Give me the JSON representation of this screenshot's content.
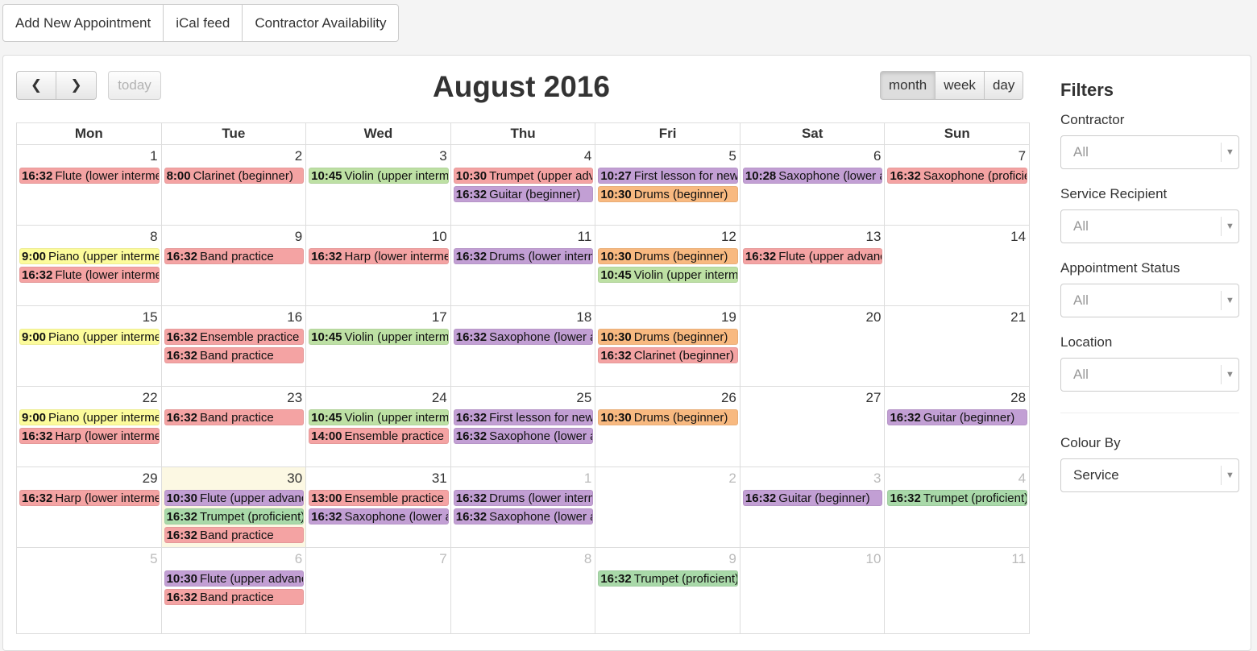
{
  "toolbar": {
    "add_appointment": "Add New Appointment",
    "ical_feed": "iCal feed",
    "contractor_availability": "Contractor Availability"
  },
  "calendar": {
    "title": "August 2016",
    "prev_icon": "❮",
    "next_icon": "❯",
    "today_label": "today",
    "views": {
      "month": "month",
      "week": "week",
      "day": "day"
    },
    "days_of_week": [
      "Mon",
      "Tue",
      "Wed",
      "Thu",
      "Fri",
      "Sat",
      "Sun"
    ],
    "colors": {
      "red": "#f4a3a3",
      "purple": "#c29fd4",
      "green": "#bde0a4",
      "orange": "#f8b980",
      "yellow": "#fcfb9b",
      "dkgreen": "#a9d9a9"
    },
    "weeks": [
      {
        "days": [
          {
            "num": "1",
            "events": [
              {
                "time": "16:32",
                "title": "Flute (lower intermediate)",
                "color": "red"
              }
            ]
          },
          {
            "num": "2",
            "events": [
              {
                "time": "8:00",
                "title": "Clarinet (beginner)",
                "color": "red"
              }
            ]
          },
          {
            "num": "3",
            "events": [
              {
                "time": "10:45",
                "title": "Violin (upper intermediate)",
                "color": "green"
              }
            ]
          },
          {
            "num": "4",
            "events": [
              {
                "time": "10:30",
                "title": "Trumpet (upper advanced)",
                "color": "red"
              },
              {
                "time": "16:32",
                "title": "Guitar (beginner)",
                "color": "purple"
              }
            ]
          },
          {
            "num": "5",
            "events": [
              {
                "time": "10:27",
                "title": "First lesson for new student",
                "color": "purple"
              },
              {
                "time": "10:30",
                "title": "Drums (beginner)",
                "color": "orange"
              }
            ]
          },
          {
            "num": "6",
            "events": [
              {
                "time": "10:28",
                "title": "Saxophone (lower advanced)",
                "color": "purple"
              }
            ]
          },
          {
            "num": "7",
            "events": [
              {
                "time": "16:32",
                "title": "Saxophone (proficient)",
                "color": "red"
              }
            ]
          }
        ]
      },
      {
        "days": [
          {
            "num": "8",
            "events": [
              {
                "time": "9:00",
                "title": "Piano (upper intermediate)",
                "color": "yellow"
              },
              {
                "time": "16:32",
                "title": "Flute (lower intermediate)",
                "color": "red"
              }
            ]
          },
          {
            "num": "9",
            "events": [
              {
                "time": "16:32",
                "title": "Band practice",
                "color": "red"
              }
            ]
          },
          {
            "num": "10",
            "events": [
              {
                "time": "16:32",
                "title": "Harp (lower intermediate)",
                "color": "red"
              }
            ]
          },
          {
            "num": "11",
            "events": [
              {
                "time": "16:32",
                "title": "Drums (lower intermediate)",
                "color": "purple"
              }
            ]
          },
          {
            "num": "12",
            "events": [
              {
                "time": "10:30",
                "title": "Drums (beginner)",
                "color": "orange"
              },
              {
                "time": "10:45",
                "title": "Violin (upper intermediate)",
                "color": "green"
              }
            ]
          },
          {
            "num": "13",
            "events": [
              {
                "time": "16:32",
                "title": "Flute (upper advanced)",
                "color": "red"
              }
            ]
          },
          {
            "num": "14",
            "events": []
          }
        ]
      },
      {
        "days": [
          {
            "num": "15",
            "events": [
              {
                "time": "9:00",
                "title": "Piano (upper intermediate)",
                "color": "yellow"
              }
            ]
          },
          {
            "num": "16",
            "events": [
              {
                "time": "16:32",
                "title": "Ensemble practice",
                "color": "red"
              },
              {
                "time": "16:32",
                "title": "Band practice",
                "color": "red"
              }
            ]
          },
          {
            "num": "17",
            "events": [
              {
                "time": "10:45",
                "title": "Violin (upper intermediate)",
                "color": "green"
              }
            ]
          },
          {
            "num": "18",
            "events": [
              {
                "time": "16:32",
                "title": "Saxophone (lower advanced)",
                "color": "purple"
              }
            ]
          },
          {
            "num": "19",
            "events": [
              {
                "time": "10:30",
                "title": "Drums (beginner)",
                "color": "orange"
              },
              {
                "time": "16:32",
                "title": "Clarinet (beginner)",
                "color": "red"
              }
            ]
          },
          {
            "num": "20",
            "events": []
          },
          {
            "num": "21",
            "events": []
          }
        ]
      },
      {
        "days": [
          {
            "num": "22",
            "events": [
              {
                "time": "9:00",
                "title": "Piano (upper intermediate)",
                "color": "yellow"
              },
              {
                "time": "16:32",
                "title": "Harp (lower intermediate)",
                "color": "red"
              }
            ]
          },
          {
            "num": "23",
            "events": [
              {
                "time": "16:32",
                "title": "Band practice",
                "color": "red"
              }
            ]
          },
          {
            "num": "24",
            "events": [
              {
                "time": "10:45",
                "title": "Violin (upper intermediate)",
                "color": "green"
              },
              {
                "time": "14:00",
                "title": "Ensemble practice",
                "color": "red"
              }
            ]
          },
          {
            "num": "25",
            "events": [
              {
                "time": "16:32",
                "title": "First lesson for new student",
                "color": "purple"
              },
              {
                "time": "16:32",
                "title": "Saxophone (lower advanced)",
                "color": "purple"
              }
            ]
          },
          {
            "num": "26",
            "events": [
              {
                "time": "10:30",
                "title": "Drums (beginner)",
                "color": "orange"
              }
            ]
          },
          {
            "num": "27",
            "events": []
          },
          {
            "num": "28",
            "events": [
              {
                "time": "16:32",
                "title": "Guitar (beginner)",
                "color": "purple"
              }
            ]
          }
        ]
      },
      {
        "days": [
          {
            "num": "29",
            "events": [
              {
                "time": "16:32",
                "title": "Harp (lower intermediate)",
                "color": "red"
              }
            ]
          },
          {
            "num": "30",
            "today": true,
            "events": [
              {
                "time": "10:30",
                "title": "Flute (upper advanced)",
                "color": "purple"
              },
              {
                "time": "16:32",
                "title": "Trumpet (proficient)",
                "color": "dkgreen"
              },
              {
                "time": "16:32",
                "title": "Band practice",
                "color": "red"
              }
            ]
          },
          {
            "num": "31",
            "events": [
              {
                "time": "13:00",
                "title": "Ensemble practice",
                "color": "red"
              },
              {
                "time": "16:32",
                "title": "Saxophone (lower advanced)",
                "color": "purple"
              }
            ]
          },
          {
            "num": "1",
            "other": true,
            "events": [
              {
                "time": "16:32",
                "title": "Drums (lower intermediate)",
                "color": "purple"
              },
              {
                "time": "16:32",
                "title": "Saxophone (lower advanced)",
                "color": "purple"
              }
            ]
          },
          {
            "num": "2",
            "other": true,
            "events": []
          },
          {
            "num": "3",
            "other": true,
            "events": [
              {
                "time": "16:32",
                "title": "Guitar (beginner)",
                "color": "purple"
              }
            ]
          },
          {
            "num": "4",
            "other": true,
            "events": [
              {
                "time": "16:32",
                "title": "Trumpet (proficient)",
                "color": "dkgreen"
              }
            ]
          }
        ]
      },
      {
        "days": [
          {
            "num": "5",
            "other": true,
            "events": []
          },
          {
            "num": "6",
            "other": true,
            "events": [
              {
                "time": "10:30",
                "title": "Flute (upper advanced)",
                "color": "purple"
              },
              {
                "time": "16:32",
                "title": "Band practice",
                "color": "red"
              }
            ]
          },
          {
            "num": "7",
            "other": true,
            "events": []
          },
          {
            "num": "8",
            "other": true,
            "events": []
          },
          {
            "num": "9",
            "other": true,
            "events": [
              {
                "time": "16:32",
                "title": "Trumpet (proficient)",
                "color": "dkgreen"
              }
            ]
          },
          {
            "num": "10",
            "other": true,
            "events": []
          },
          {
            "num": "11",
            "other": true,
            "events": []
          }
        ]
      }
    ]
  },
  "filters": {
    "title": "Filters",
    "contractor": {
      "label": "Contractor",
      "value": "All"
    },
    "service_recipient": {
      "label": "Service Recipient",
      "value": "All"
    },
    "appointment_status": {
      "label": "Appointment Status",
      "value": "All"
    },
    "location": {
      "label": "Location",
      "value": "All"
    },
    "colour_by": {
      "label": "Colour By",
      "value": "Service"
    },
    "dropdown_icon": "▼"
  }
}
